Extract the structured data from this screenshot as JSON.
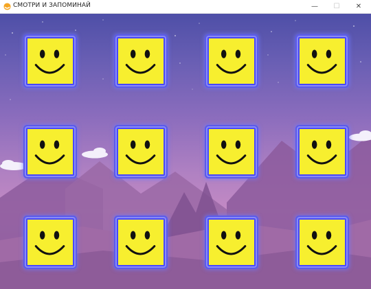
{
  "window": {
    "title": "СМОТРИ И ЗАПОМИНАЙ",
    "minimize_glyph": "—",
    "maximize_glyph": "☐",
    "close_glyph": "✕"
  },
  "board": {
    "rows": 3,
    "columns": 4,
    "tiles": [
      {
        "id": 1,
        "face": "smiley-icon"
      },
      {
        "id": 2,
        "face": "smiley-icon"
      },
      {
        "id": 3,
        "face": "smiley-icon"
      },
      {
        "id": 4,
        "face": "smiley-icon"
      },
      {
        "id": 5,
        "face": "smiley-icon"
      },
      {
        "id": 6,
        "face": "smiley-icon"
      },
      {
        "id": 7,
        "face": "smiley-icon"
      },
      {
        "id": 8,
        "face": "smiley-icon"
      },
      {
        "id": 9,
        "face": "smiley-icon"
      },
      {
        "id": 10,
        "face": "smiley-icon"
      },
      {
        "id": 11,
        "face": "smiley-icon"
      },
      {
        "id": 12,
        "face": "smiley-icon"
      }
    ]
  },
  "colors": {
    "tile_face": "#f7ef2f",
    "tile_border": "#4848ff",
    "sky_top": "#4e4fa7",
    "sky_bottom": "#c48ac4"
  }
}
